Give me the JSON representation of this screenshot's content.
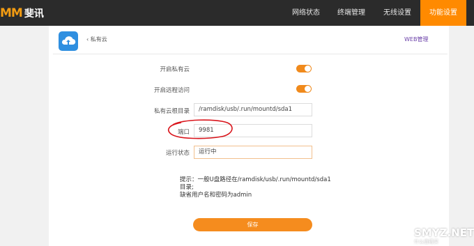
{
  "brand": {
    "mark": "MM",
    "name": "斐讯"
  },
  "nav": [
    {
      "label": "网络状态"
    },
    {
      "label": "终端管理"
    },
    {
      "label": "无线设置"
    },
    {
      "label": "功能设置"
    }
  ],
  "colors": {
    "accent": "#ff8a00",
    "topbar": "#2b2b2b",
    "icon_blue": "#2f8fe0",
    "annotation": "#d9141b"
  },
  "header": {
    "back_label": "私有云",
    "web_link": "WEB管理",
    "app_icon": "cloud-upload-icon"
  },
  "form": {
    "enable_cloud": {
      "label": "开启私有云",
      "on": true
    },
    "remote_access": {
      "label": "开启远程访问",
      "on": true
    },
    "root_dir": {
      "label": "私有云根目录",
      "value": "/ramdisk/usb/.run/mountd/sda1"
    },
    "port": {
      "label": "端口",
      "value": "9981"
    },
    "status": {
      "label": "运行状态",
      "value": "运行中"
    }
  },
  "hint": {
    "line1": "提示：一般U盘路径在/ramdisk/usb/.run/mountd/sda1",
    "line2": "目录;",
    "line3": "缺省用户名和密码为admin"
  },
  "save_label": "保存",
  "watermark": {
    "text": "SMYZ.NET",
    "sub": "什么值得买"
  }
}
